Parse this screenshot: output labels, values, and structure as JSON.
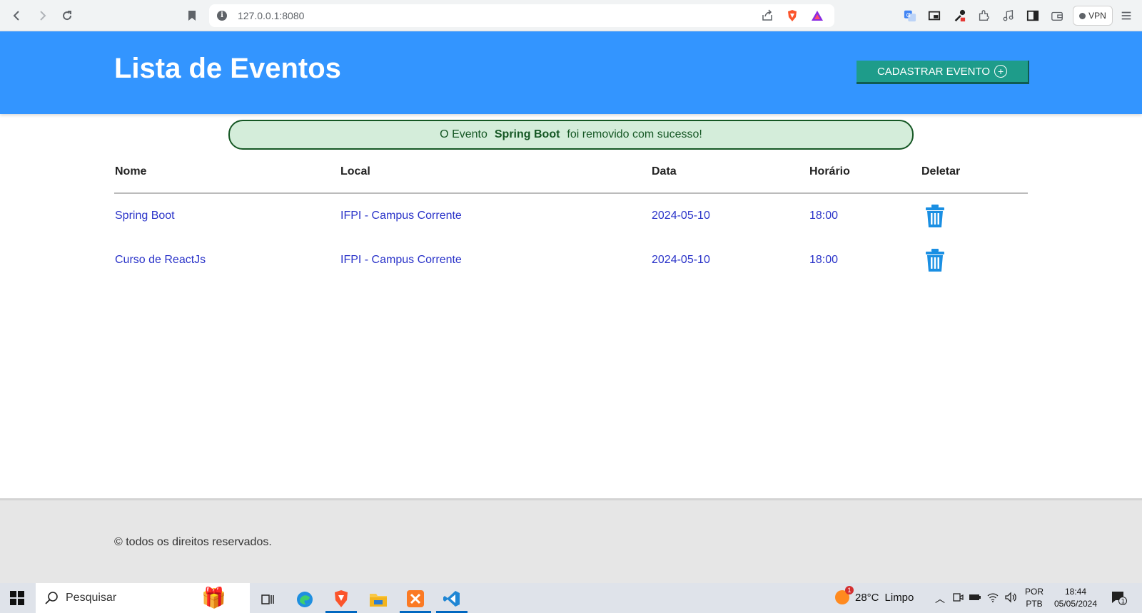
{
  "browser": {
    "url": "127.0.0.1:8080",
    "vpn_label": "VPN"
  },
  "header": {
    "title": "Lista de Eventos",
    "add_button_label": "CADASTRAR EVENTO",
    "add_button_icon": "plus-circle-icon",
    "background_color": "#3395ff",
    "button_color": "#1e9c8a"
  },
  "alert": {
    "prefix": "O Evento",
    "event_name": "Spring Boot",
    "suffix": "foi removido com sucesso!",
    "background_color": "#d4edda",
    "text_color": "#155724"
  },
  "table": {
    "headers": [
      "Nome",
      "Local",
      "Data",
      "Horário",
      "Deletar"
    ],
    "rows": [
      {
        "nome": "Spring Boot",
        "local": "IFPI - Campus Corrente",
        "data": "2024-05-10",
        "horario": "18:00",
        "delete_icon": "trash-icon"
      },
      {
        "nome": "Curso de ReactJs",
        "local": "IFPI - Campus Corrente",
        "data": "2024-05-10",
        "horario": "18:00",
        "delete_icon": "trash-icon"
      }
    ],
    "link_color": "#2b34c9",
    "trash_color": "#1a8fe3"
  },
  "footer": {
    "text": "© todos os direitos reservados."
  },
  "taskbar": {
    "search_placeholder": "Pesquisar",
    "weather_temp": "28°C",
    "weather_desc": "Limpo",
    "weather_badge": "1",
    "lang_top": "POR",
    "lang_bottom": "PTB",
    "time": "18:44",
    "date": "05/05/2024",
    "notification_count": "1"
  }
}
